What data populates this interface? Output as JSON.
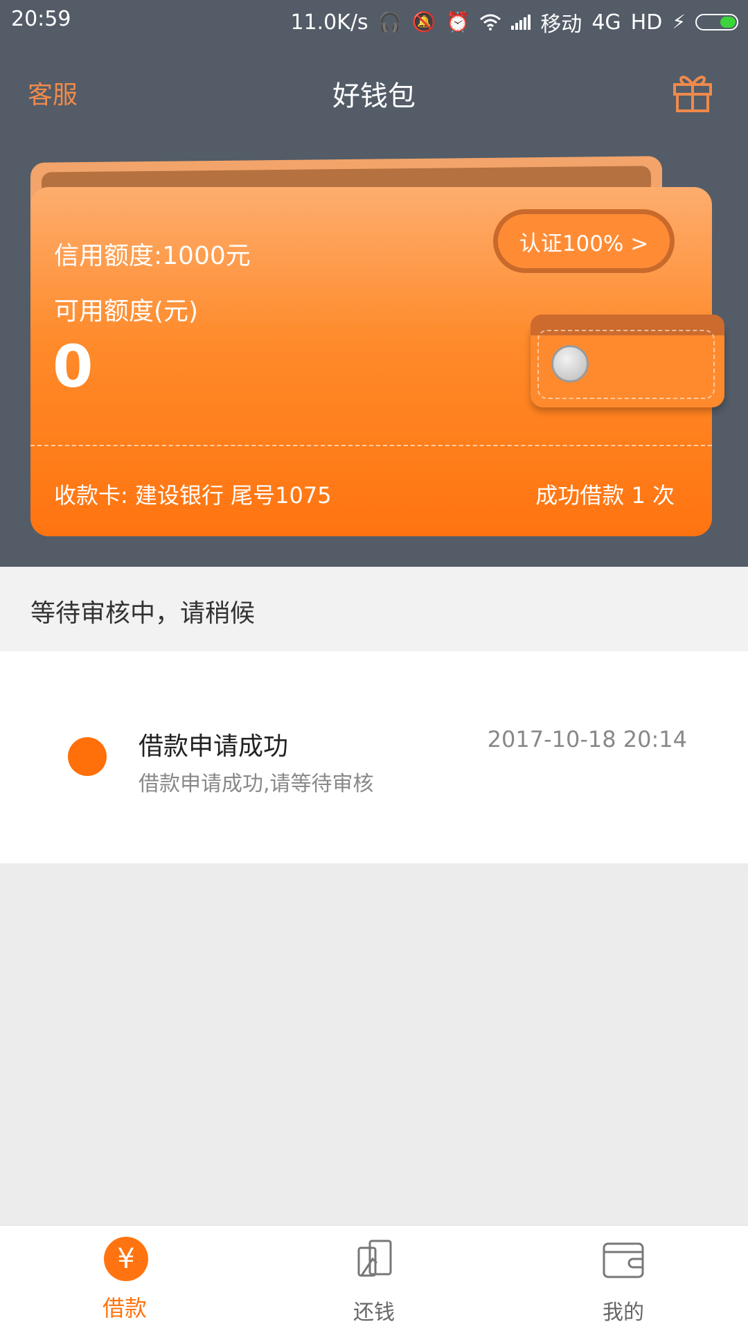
{
  "status_bar": {
    "time": "20:59",
    "speed": "11.0K/s",
    "carrier": "移动",
    "network": "4G",
    "hd": "HD",
    "icons": [
      "headphones-icon",
      "mute-icon",
      "alarm-icon",
      "wifi-icon",
      "signal-icon",
      "charging-icon",
      "battery-icon"
    ]
  },
  "header": {
    "left_link": "客服",
    "title": "好钱包",
    "right_icon": "gift-icon"
  },
  "wallet": {
    "credit_line": "信用额度:1000元",
    "auth_button": "认证100% >",
    "available_label": "可用额度(元)",
    "available_value": "0",
    "bank_card": "收款卡: 建设银行 尾号1075",
    "loan_count": "成功借款 1 次"
  },
  "review_status": "等待审核中，请稍候",
  "timeline": [
    {
      "title": "借款申请成功",
      "description": "借款申请成功,请等待审核",
      "time": "2017-10-18 20:14"
    }
  ],
  "bottom_nav": [
    {
      "label": "借款",
      "icon": "yuan-icon",
      "active": true
    },
    {
      "label": "还钱",
      "icon": "repay-icon",
      "active": false
    },
    {
      "label": "我的",
      "icon": "wallet-icon",
      "active": false
    }
  ],
  "colors": {
    "accent": "#ff7410",
    "header_bg": "#535c67",
    "link": "#f08a4b"
  }
}
